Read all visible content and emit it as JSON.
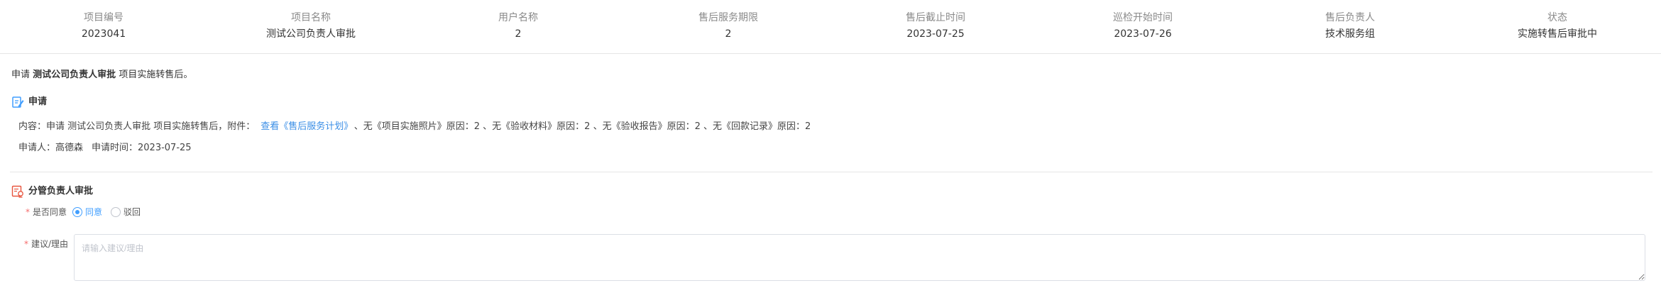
{
  "summary": [
    {
      "label": "项目编号",
      "value": "2023041"
    },
    {
      "label": "项目名称",
      "value": "测试公司负责人审批"
    },
    {
      "label": "用户名称",
      "value": "2"
    },
    {
      "label": "售后服务期限",
      "value": "2"
    },
    {
      "label": "售后截止时间",
      "value": "2023-07-25"
    },
    {
      "label": "巡检开始时间",
      "value": "2023-07-26"
    },
    {
      "label": "售后负责人",
      "value": "技术服务组"
    },
    {
      "label": "状态",
      "value": "实施转售后审批中"
    }
  ],
  "intro": {
    "prefix": "申请",
    "project": "测试公司负责人审批",
    "suffix": "项目实施转售后。"
  },
  "apply_section": {
    "title": "申请",
    "content_prefix": "内容：申请 测试公司负责人审批 项目实施转售后，附件：",
    "content_link": "查看《售后服务计划》",
    "content_suffix": "、无《项目实施照片》原因：2 、无《验收材料》原因：2 、无《验收报告》原因：2 、无《回款记录》原因：2",
    "applicant": "申请人：高德森",
    "apply_time": "申请时间：2023-07-25"
  },
  "review_section": {
    "title": "分管负责人审批",
    "agree_label": "是否同意",
    "options": [
      {
        "label": "同意",
        "checked": true
      },
      {
        "label": "驳回",
        "checked": false
      }
    ],
    "reason_label": "建议/理由",
    "reason_placeholder": "请输入建议/理由",
    "reason_value": ""
  },
  "colors": {
    "accent": "#409eff",
    "link": "#3a8ee6",
    "required": "#f56c6c",
    "review_icon": "#e8553e"
  },
  "icons": {
    "apply": "edit-document-icon",
    "review": "approval-document-icon"
  }
}
